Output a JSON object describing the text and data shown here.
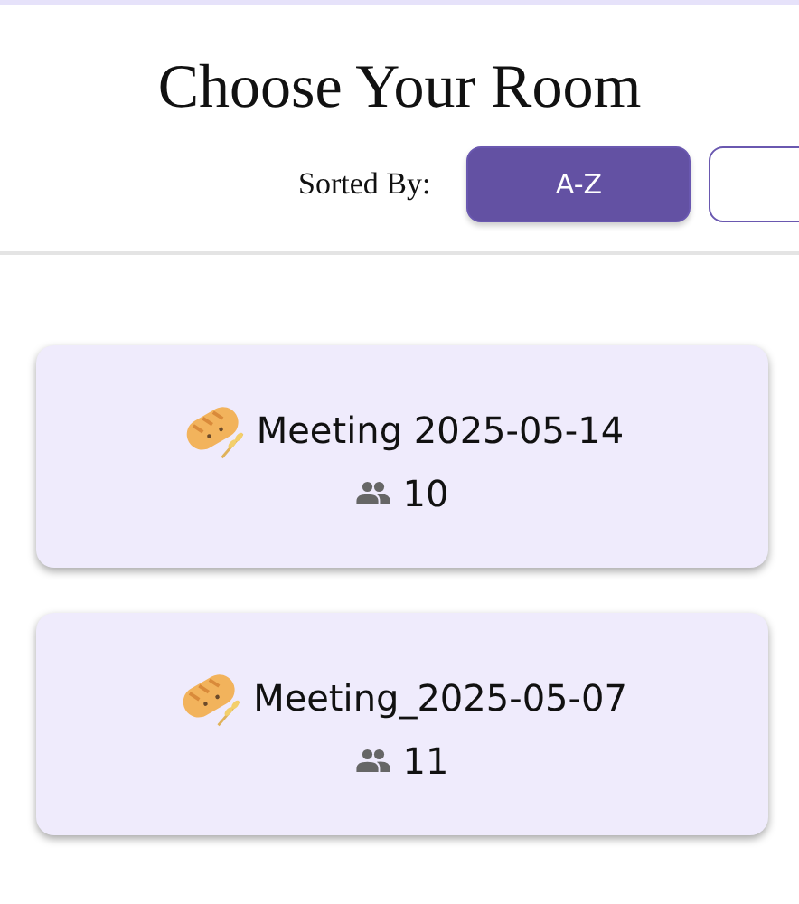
{
  "title": "Choose Your Room",
  "sort": {
    "label": "Sorted By:",
    "buttons": [
      {
        "label": "A-Z",
        "selected": true
      },
      {
        "selected": false
      }
    ]
  },
  "rooms": [
    {
      "name": "Meeting 2025-05-14",
      "members": "10"
    },
    {
      "name": "Meeting_2025-05-07",
      "members": "11"
    }
  ]
}
